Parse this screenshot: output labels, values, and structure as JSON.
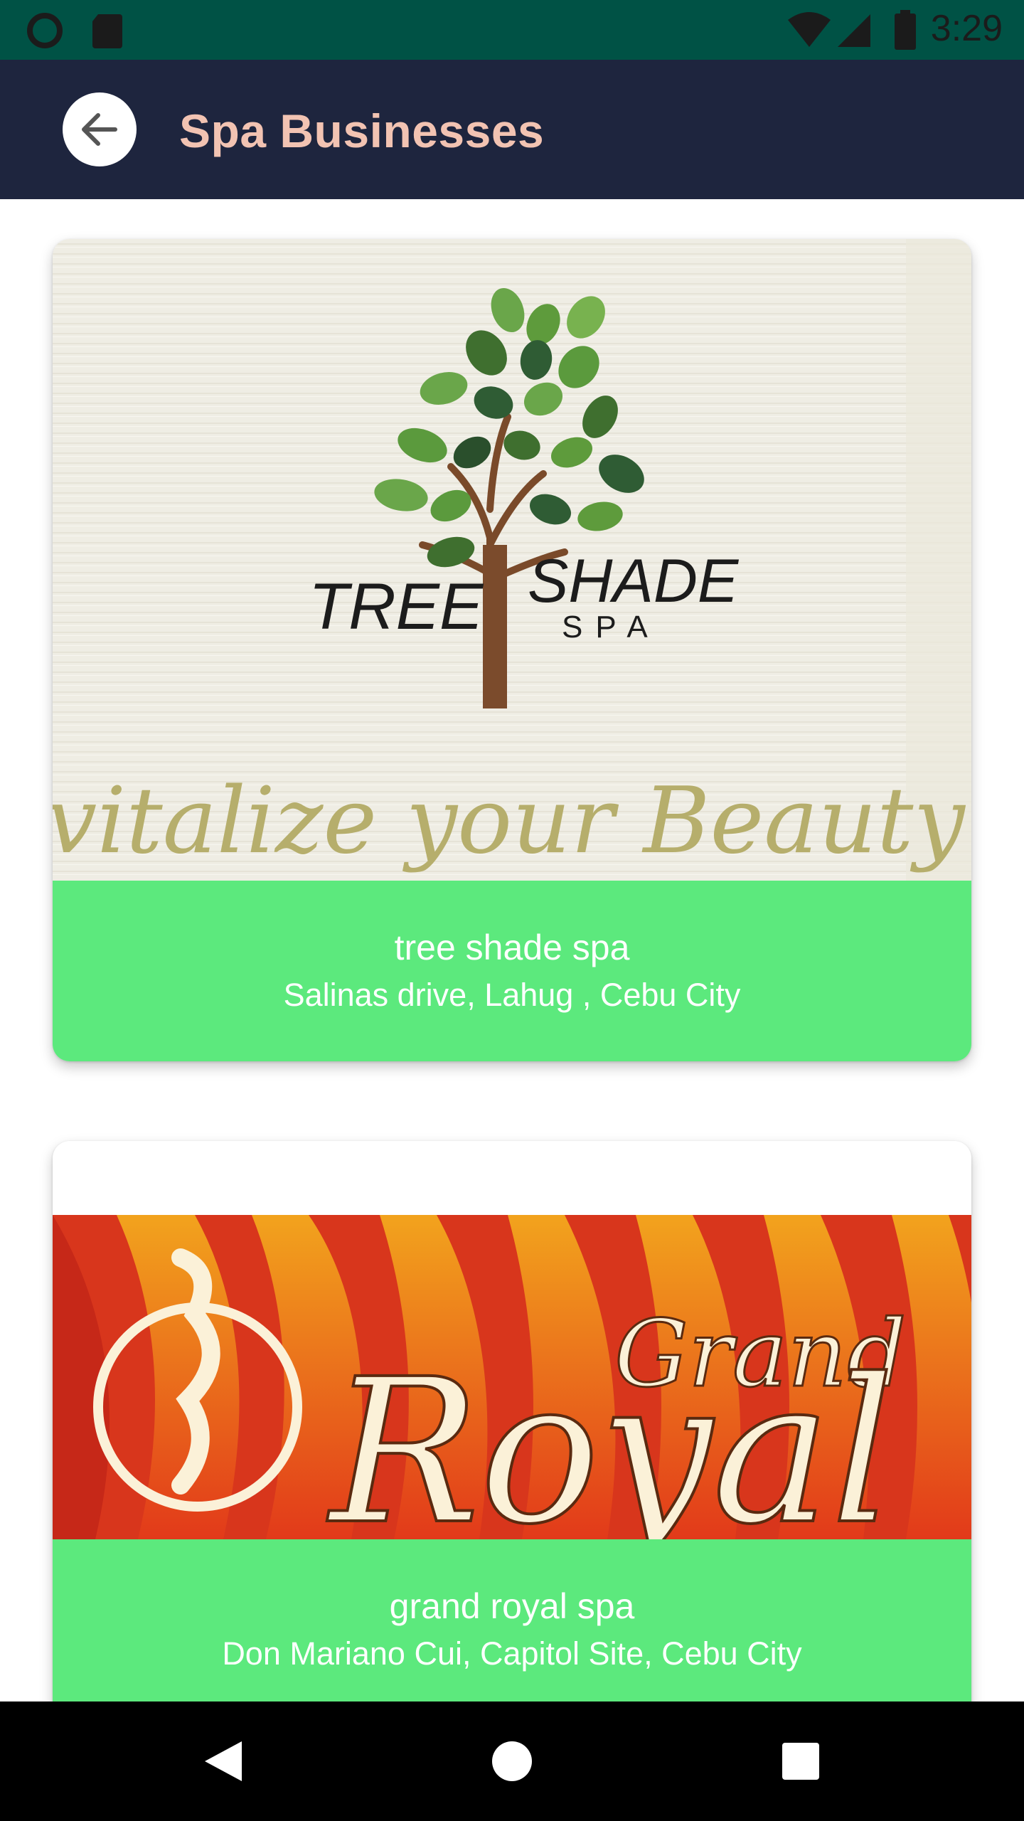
{
  "status_bar": {
    "time": "3:29",
    "icons": [
      "sync-circle-icon",
      "sd-card-icon",
      "wifi-icon",
      "cell-signal-icon",
      "battery-icon"
    ]
  },
  "app_bar": {
    "title": "Spa Businesses",
    "back_icon": "arrow-back-icon"
  },
  "businesses": [
    {
      "name": "tree shade spa",
      "address": "Salinas drive, Lahug , Cebu City",
      "logo_text": "TREE SHADE SPA",
      "tagline": "vitalize your Beauty"
    },
    {
      "name": "grand royal spa",
      "address": "Don Mariano Cui, Capitol Site, Cebu City",
      "logo_text": "Grand Royal"
    }
  ],
  "nav_bar": {
    "icons": [
      "back-triangle-icon",
      "home-circle-icon",
      "recents-square-icon"
    ]
  },
  "colors": {
    "status_bar": "#005245",
    "app_bar": "#1e253e",
    "title": "#f2c3b2",
    "card_footer": "#5ce97d",
    "nav_bar": "#000000"
  }
}
